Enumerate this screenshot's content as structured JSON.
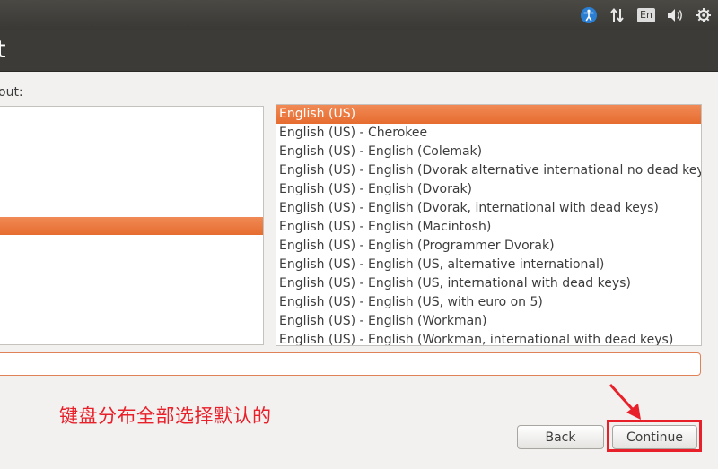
{
  "tray": {
    "accessibility_icon": "accessibility-icon",
    "network_icon": "network-arrows-icon",
    "language": "En",
    "volume_icon": "speaker-icon",
    "settings_icon": "gear-icon"
  },
  "window": {
    "title": "t"
  },
  "layout_label": "out:",
  "variants": [
    "English (US)",
    "English (US) - Cherokee",
    "English (US) - English (Colemak)",
    "English (US) - English (Dvorak alternative international no dead keys)",
    "English (US) - English (Dvorak)",
    "English (US) - English (Dvorak, international with dead keys)",
    "English (US) - English (Macintosh)",
    "English (US) - English (Programmer Dvorak)",
    "English (US) - English (US, alternative international)",
    "English (US) - English (US, international with dead keys)",
    "English (US) - English (US, with euro on 5)",
    "English (US) - English (Workman)",
    "English (US) - English (Workman, international with dead keys)"
  ],
  "selected_variant_index": 0,
  "test_field": {
    "value": ""
  },
  "annotation": "键盘分布全部选择默认的",
  "buttons": {
    "back": "Back",
    "continue": "Continue"
  },
  "colors": {
    "selection": "#e86f33",
    "annotation": "#e8202a",
    "titlebar": "#3c3b37"
  }
}
